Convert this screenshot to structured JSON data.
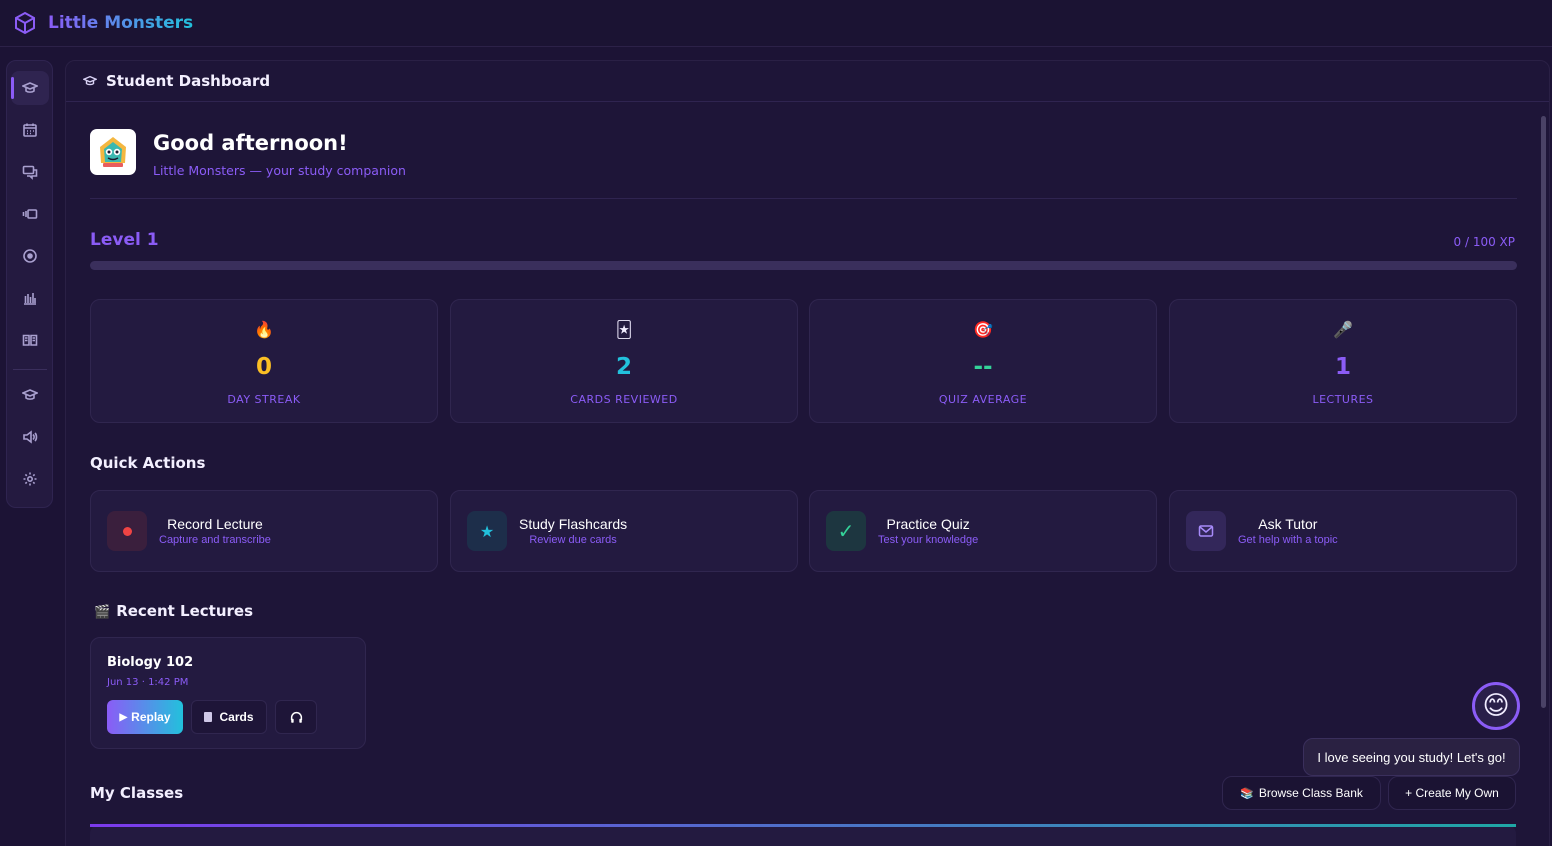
{
  "app": {
    "name": "Little Monsters"
  },
  "header": {
    "title": "Student Dashboard"
  },
  "greeting": {
    "title": "Good afternoon!",
    "subtitle": "Little Monsters — your study companion"
  },
  "level": {
    "label": "Level 1",
    "xp_text": "0 / 100 XP",
    "progress_fraction": 0
  },
  "stats": [
    {
      "icon": "fire-icon",
      "glyph": "🔥",
      "value": "0",
      "label": "DAY STREAK",
      "color": "#fbbf24"
    },
    {
      "icon": "cards-icon",
      "glyph": "🃏",
      "value": "2",
      "label": "CARDS REVIEWED",
      "color": "#22c1dc"
    },
    {
      "icon": "target-icon",
      "glyph": "🎯",
      "value": "--",
      "label": "QUIZ AVERAGE",
      "color": "#34d399"
    },
    {
      "icon": "microphone-icon",
      "glyph": "🎤",
      "value": "1",
      "label": "LECTURES",
      "color": "#8b5cf6"
    }
  ],
  "quick_actions": {
    "title": "Quick Actions",
    "items": [
      {
        "label": "Record Lecture",
        "sub": "Capture and transcribe",
        "icon": "record-icon"
      },
      {
        "label": "Study Flashcards",
        "sub": "Review due cards",
        "icon": "star-icon"
      },
      {
        "label": "Practice Quiz",
        "sub": "Test your knowledge",
        "icon": "check-icon"
      },
      {
        "label": "Ask Tutor",
        "sub": "Get help with a topic",
        "icon": "mail-icon"
      }
    ]
  },
  "recent_lectures": {
    "title": "Recent Lectures",
    "items": [
      {
        "title": "Biology 102",
        "date": "Jun 13 · 1:42 PM",
        "replay_label": "Replay",
        "cards_label": "Cards"
      }
    ]
  },
  "classes": {
    "title": "My Classes",
    "browse_label": "Browse Class Bank",
    "create_label": "+ Create My Own"
  },
  "mascot": {
    "message": "I love seeing you study! Let's go!"
  },
  "colors": {
    "accent": "#8b5cf6",
    "teal": "#22c1dc",
    "background": "#1c1335"
  }
}
